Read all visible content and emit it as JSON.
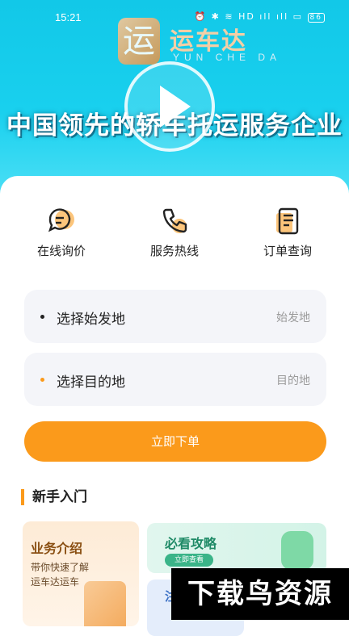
{
  "status_bar": {
    "time": "15:21",
    "icons": "⏰ ✱ ≋ HD ıll ıll ▭",
    "battery": "86"
  },
  "banner": {
    "logo_char": "运",
    "logo_name": "运车达",
    "logo_pinyin": "YUN CHE DA",
    "slogan": "中国领先的轿车托运服务企业"
  },
  "quick_actions": [
    {
      "label": "在线询价",
      "icon": "chat-icon"
    },
    {
      "label": "服务热线",
      "icon": "phone-icon"
    },
    {
      "label": "订单查询",
      "icon": "document-icon"
    }
  ],
  "form": {
    "origin_label": "选择始发地",
    "origin_placeholder": "始发地",
    "destination_label": "选择目的地",
    "destination_placeholder": "目的地",
    "submit_label": "立即下单"
  },
  "section": {
    "title": "新手入门"
  },
  "tiles": {
    "business": {
      "title": "业务介绍",
      "line1": "带你快速了解",
      "line2": "运车达运车"
    },
    "guide": {
      "title": "必看攻略",
      "button": "立即查看"
    },
    "third": {
      "title": "注"
    }
  },
  "watermark": "下载鸟资源",
  "colors": {
    "accent": "#fb9a1b",
    "banner": "#19d0ee"
  }
}
